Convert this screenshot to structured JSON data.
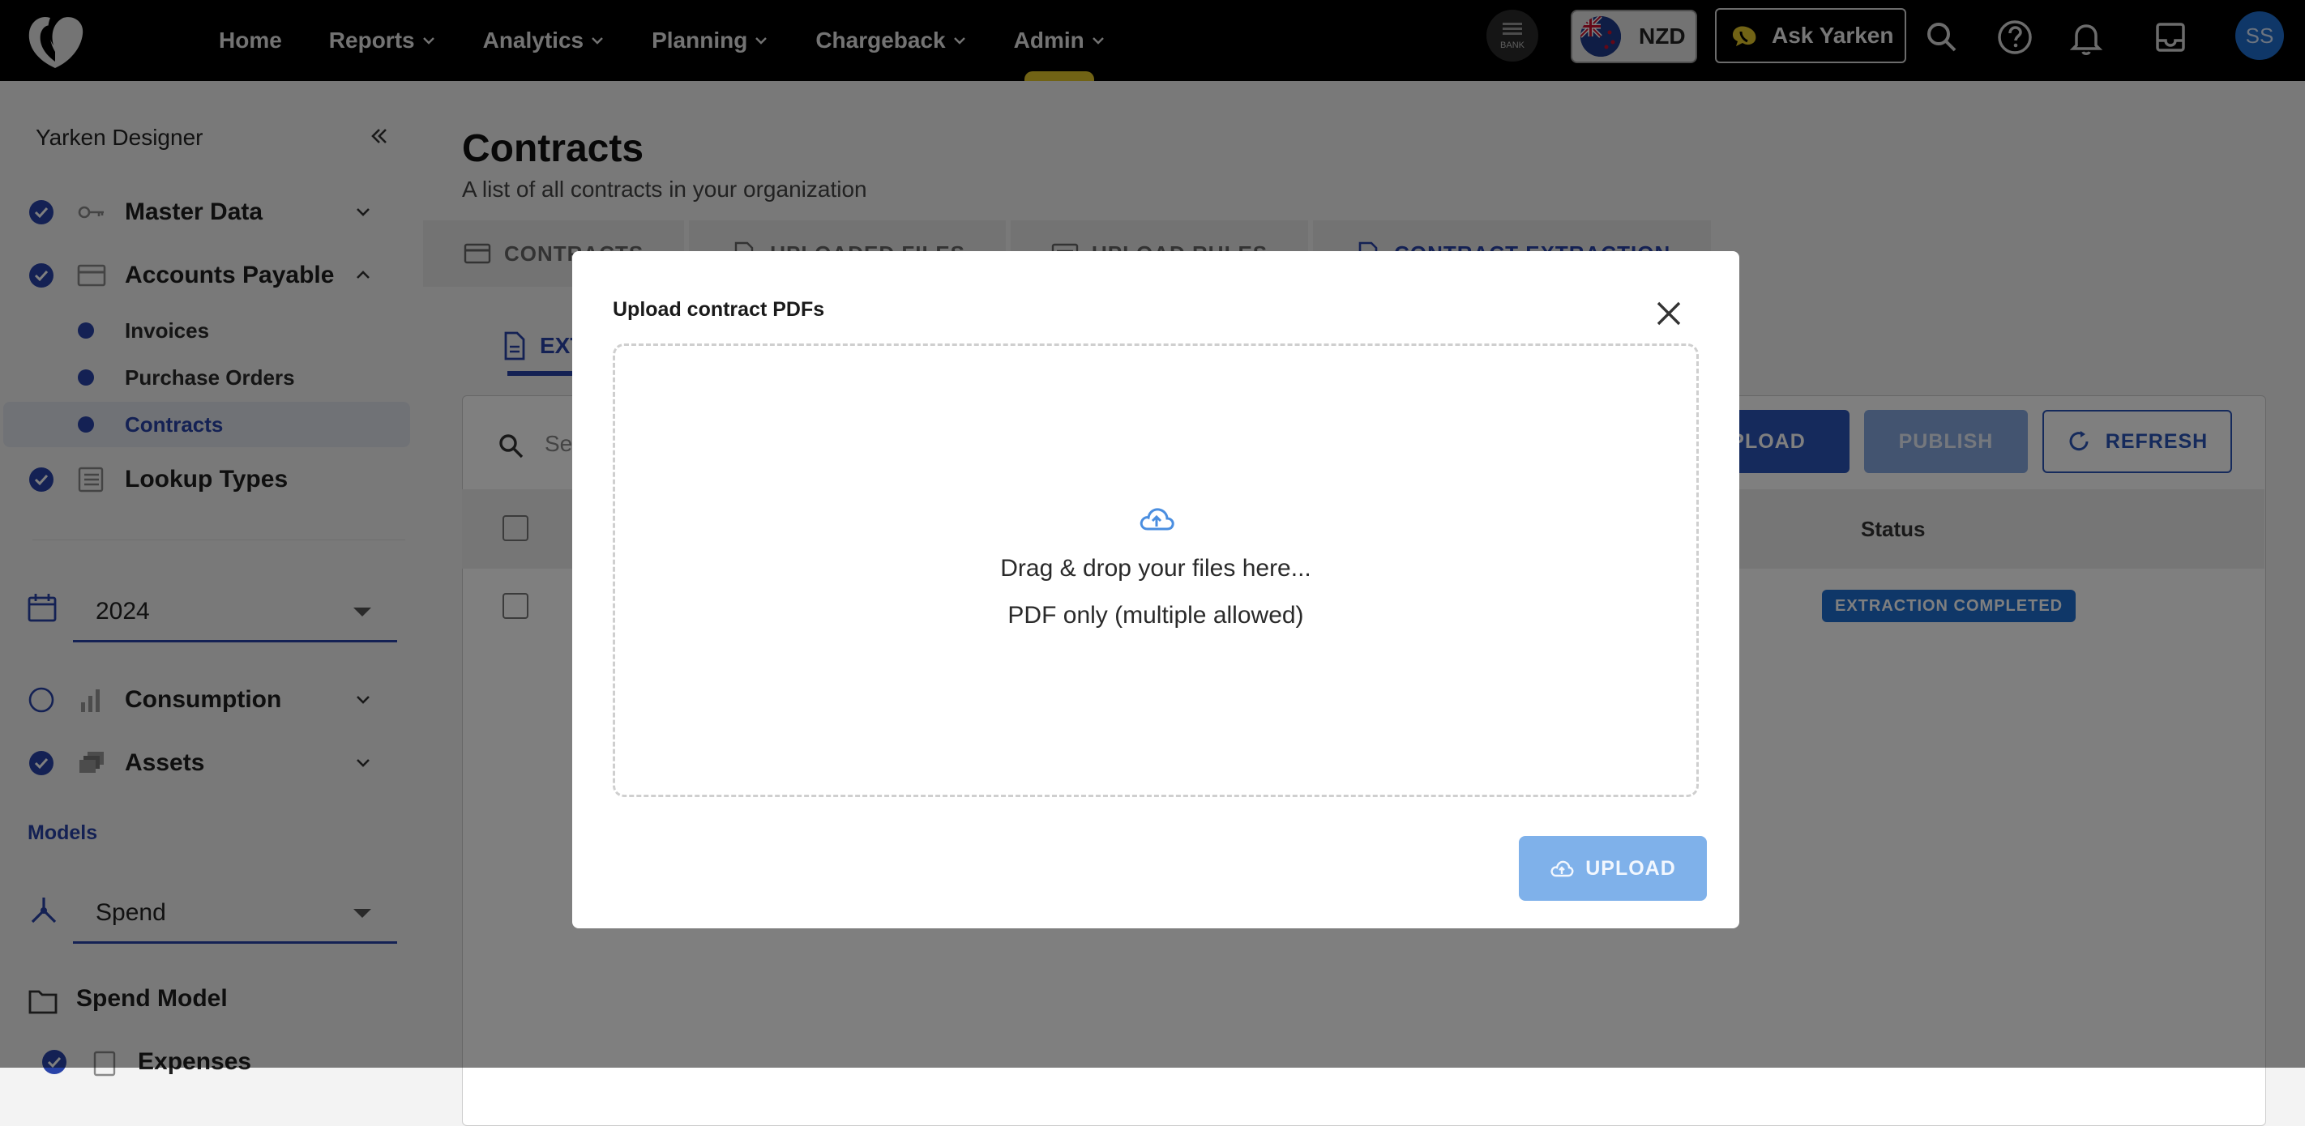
{
  "nav": {
    "items": [
      {
        "label": "Home",
        "has_menu": false
      },
      {
        "label": "Reports",
        "has_menu": true
      },
      {
        "label": "Analytics",
        "has_menu": true
      },
      {
        "label": "Planning",
        "has_menu": true
      },
      {
        "label": "Chargeback",
        "has_menu": true
      },
      {
        "label": "Admin",
        "has_menu": true
      }
    ],
    "bank_label": "BANK",
    "currency": "NZD",
    "ask_label": "Ask Yarken",
    "avatar_initials": "SS"
  },
  "sidebar": {
    "title": "Yarken Designer",
    "master_data": "Master Data",
    "accounts_payable": "Accounts Payable",
    "sub_items": [
      "Invoices",
      "Purchase Orders",
      "Contracts"
    ],
    "lookup_types": "Lookup Types",
    "year": "2024",
    "consumption": "Consumption",
    "assets": "Assets",
    "models_section": "Models",
    "model_select": "Spend",
    "spend_model": "Spend Model",
    "expenses": "Expenses"
  },
  "main": {
    "title": "Contracts",
    "subtitle": "A list of all contracts in your organization",
    "tabs": [
      "CONTRACTS",
      "UPLOADED FILES",
      "UPLOAD RULES",
      "CONTRACT EXTRACTION"
    ],
    "subtab_label": "EXT",
    "search_placeholder": "Se",
    "upload_label": "UPLOAD",
    "publish_label": "PUBLISH",
    "refresh_label": "REFRESH",
    "status_header": "Status",
    "row_status": "EXTRACTION COMPLETED"
  },
  "modal": {
    "title": "Upload contract PDFs",
    "drop_text": "Drag & drop your files here...",
    "drop_hint": "PDF only (multiple allowed)",
    "upload_label": "UPLOAD"
  },
  "colors": {
    "accent": "#2843a8",
    "primary_button": "#2a55b8",
    "disabled_button": "#7fb1ea",
    "status_badge": "#1f6fd0",
    "admin_indicator": "#e3c62a"
  }
}
